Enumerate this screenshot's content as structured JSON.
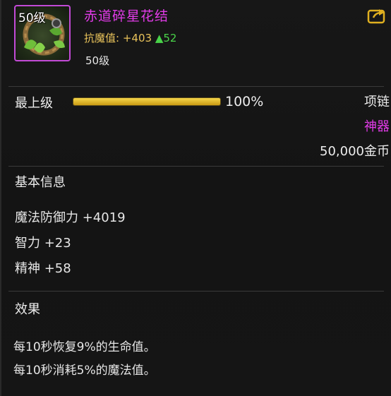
{
  "header": {
    "icon_level": "50级",
    "name": "赤道碎星花结",
    "stat_label": "抗魔值:",
    "stat_value": "+403",
    "stat_up": "▲52",
    "level": "50级",
    "share_icon": "share-arrow-icon",
    "name_color": "#e23be8"
  },
  "quality": {
    "label": "最上级",
    "percent_text": "100%",
    "fill_fraction": 1.0,
    "slot": "项链",
    "rarity": "神器",
    "rarity_color": "#e23be8",
    "price": "50,000金币"
  },
  "basic_info": {
    "title": "基本信息",
    "lines": [
      "魔法防御力 +4019",
      "智力 +23",
      "精神 +58"
    ]
  },
  "effect": {
    "title": "效果",
    "lines": [
      "每10秒恢复9%的生命值。",
      "每10秒消耗5%的魔法值。"
    ]
  }
}
